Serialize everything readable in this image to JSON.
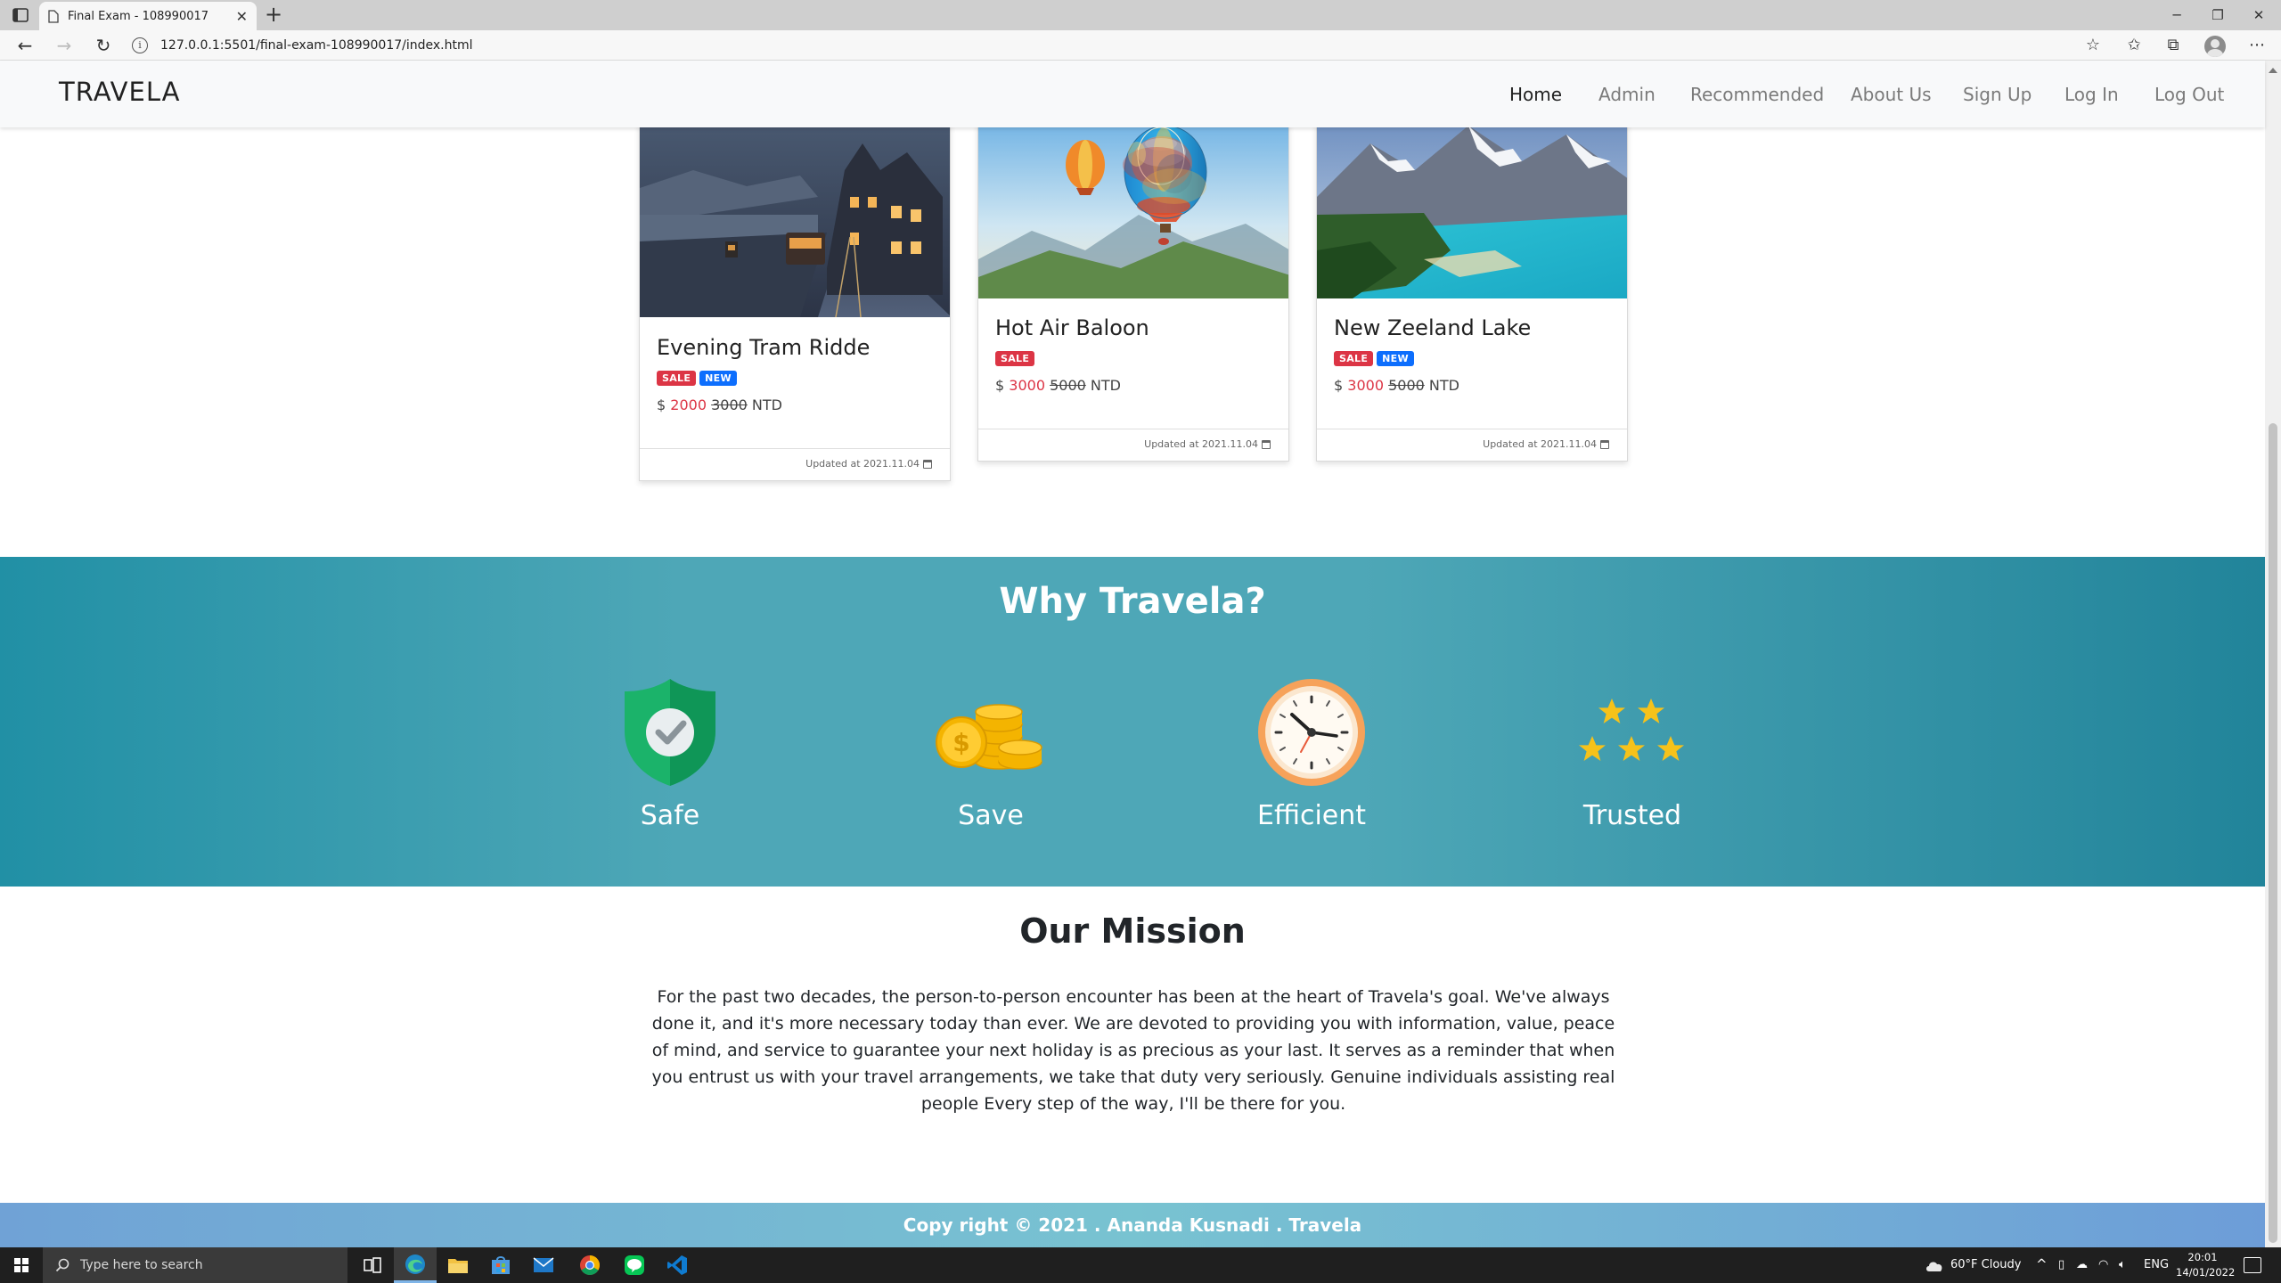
{
  "browser": {
    "tab_title": "Final Exam - 108990017",
    "url": "127.0.0.1:5501/final-exam-108990017/index.html"
  },
  "navbar": {
    "brand": "TRAVELA",
    "links": [
      "Home",
      "Admin",
      "Recommended",
      "About Us",
      "Sign Up",
      "Log In",
      "Log Out"
    ],
    "active": "Home"
  },
  "cards": [
    {
      "title": "Evening Tram Ridde",
      "badges": [
        "SALE",
        "NEW"
      ],
      "currency": "$",
      "price": "2000",
      "old_price": "3000",
      "unit": "NTD",
      "updated": "Updated at 2021.11.04"
    },
    {
      "title": "Hot Air Baloon",
      "badges": [
        "SALE"
      ],
      "currency": "$",
      "price": "3000",
      "old_price": "5000",
      "unit": "NTD",
      "updated": "Updated at 2021.11.04"
    },
    {
      "title": "New Zeeland Lake",
      "badges": [
        "SALE",
        "NEW"
      ],
      "currency": "$",
      "price": "3000",
      "old_price": "5000",
      "unit": "NTD",
      "updated": "Updated at 2021.11.04"
    }
  ],
  "why": {
    "title": "Why Travela?",
    "features": [
      {
        "label": "Safe",
        "icon": "shield-check-icon"
      },
      {
        "label": "Save",
        "icon": "coins-icon"
      },
      {
        "label": "Efficient",
        "icon": "clock-icon"
      },
      {
        "label": "Trusted",
        "icon": "stars-icon"
      }
    ]
  },
  "mission": {
    "title": "Our Mission",
    "text": "For the past two decades, the person-to-person encounter has been at the heart of Travela's goal. We've always done it, and it's more necessary today than ever. We are devoted to providing you with information, value, peace of mind, and service to guarantee your next holiday is as precious as your last. It serves as a reminder that when you entrust us with your travel arrangements, we take that duty very seriously. Genuine individuals assisting real people Every step of the way, I'll be there for you."
  },
  "footer": {
    "text": "Copy right © 2021 . Ananda Kusnadi . Travela"
  },
  "taskbar": {
    "search_placeholder": "Type here to search",
    "weather": "60°F  Cloudy",
    "language": "ENG",
    "time": "20:01",
    "date": "14/01/2022"
  },
  "colors": {
    "sale": "#dc3545",
    "new": "#0d6efd",
    "why_bg": "#4ea7b7",
    "footer_bg": "#78c3d1"
  }
}
